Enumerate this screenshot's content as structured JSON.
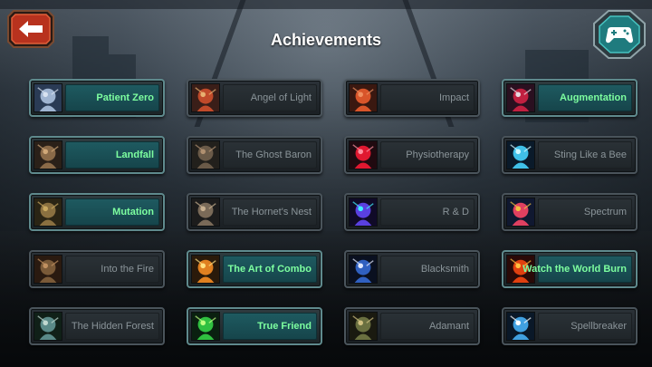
{
  "header": {
    "title": "Achievements"
  },
  "buttons": {
    "back_icon": "arrow-left-icon",
    "gamepad_icon": "gamepad-icon"
  },
  "colors": {
    "unlocked_text": "#7dffa0",
    "locked_text": "#8a9499",
    "accent_teal": "#1e5a60"
  },
  "achievements": [
    {
      "label": "Patient Zero",
      "unlocked": true
    },
    {
      "label": "Angel of Light",
      "unlocked": false
    },
    {
      "label": "Impact",
      "unlocked": false
    },
    {
      "label": "Augmentation",
      "unlocked": true
    },
    {
      "label": "Landfall",
      "unlocked": true
    },
    {
      "label": "The Ghost Baron",
      "unlocked": false
    },
    {
      "label": "Physiotherapy",
      "unlocked": false
    },
    {
      "label": "Sting Like a Bee",
      "unlocked": false
    },
    {
      "label": "Mutation",
      "unlocked": true
    },
    {
      "label": "The Hornet's Nest",
      "unlocked": false
    },
    {
      "label": "R & D",
      "unlocked": false
    },
    {
      "label": "Spectrum",
      "unlocked": false
    },
    {
      "label": "Into the Fire",
      "unlocked": false
    },
    {
      "label": "The Art of Combo",
      "unlocked": true
    },
    {
      "label": "Blacksmith",
      "unlocked": false
    },
    {
      "label": "Watch the World Burn",
      "unlocked": true
    },
    {
      "label": "The Hidden Forest",
      "unlocked": false
    },
    {
      "label": "True Friend",
      "unlocked": true
    },
    {
      "label": "Adamant",
      "unlocked": false
    },
    {
      "label": "Spellbreaker",
      "unlocked": false
    }
  ]
}
